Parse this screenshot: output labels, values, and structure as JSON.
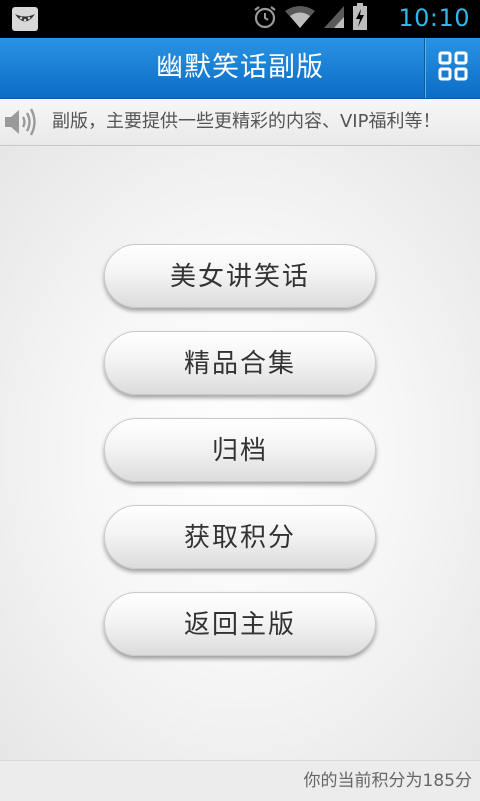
{
  "status_bar": {
    "time": "10:10",
    "icons": [
      "app-notification-icon",
      "alarm-icon",
      "wifi-icon",
      "signal-icon",
      "battery-charging-icon"
    ]
  },
  "header": {
    "title": "幽默笑话副版",
    "menu_icon": "grid-icon"
  },
  "notice": {
    "icon": "speaker-icon",
    "text": "副版，主要提供一些更精彩的内容、VIP福利等！"
  },
  "menu": {
    "buttons": [
      {
        "label": "美女讲笑话"
      },
      {
        "label": "精品合集"
      },
      {
        "label": "归档"
      },
      {
        "label": "获取积分"
      },
      {
        "label": "返回主版"
      }
    ]
  },
  "footer": {
    "points_text": "你的当前积分为185分"
  },
  "colors": {
    "accent": "#1680d6",
    "time": "#33b5e5"
  }
}
